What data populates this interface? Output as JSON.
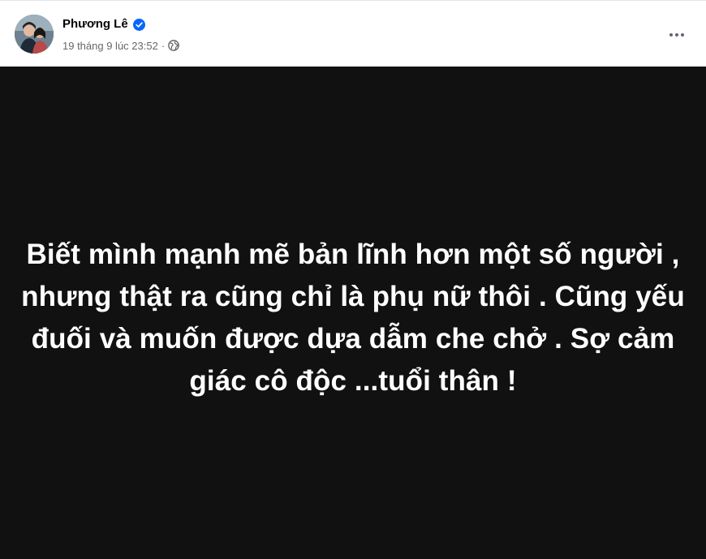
{
  "header": {
    "author_name": "Phương Lê",
    "timestamp": "19 tháng 9 lúc 23:52",
    "separator": "·",
    "audience_icon": "globe-icon",
    "verified_icon": "verified-badge-icon",
    "more_icon": "more-options-icon"
  },
  "post": {
    "text": "Biết mình mạnh mẽ bản lĩnh hơn một số người , nhưng thật ra cũng chỉ là phụ nữ thôi . Cũng yếu đuối và muốn được dựa dẫm che chở . Sợ cảm giác cô độc ...tuổi thân !",
    "background_color": "#111111",
    "text_color": "#ffffff"
  },
  "colors": {
    "verified_blue": "#0866ff",
    "meta_gray": "#65676b"
  }
}
